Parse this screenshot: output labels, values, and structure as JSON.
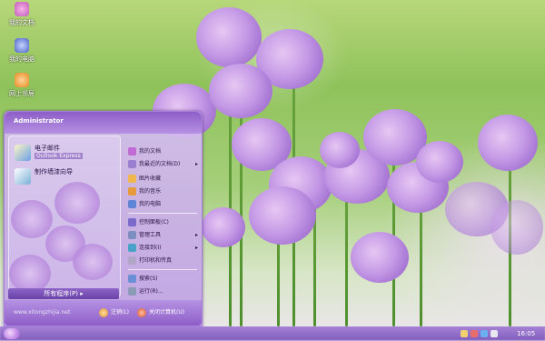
{
  "desktop": {
    "icons": [
      {
        "name": "我的文档",
        "icon": "my-documents-icon"
      },
      {
        "name": "我的电脑",
        "icon": "my-computer-icon"
      },
      {
        "name": "网上邻居",
        "icon": "network-places-icon"
      }
    ]
  },
  "start_menu": {
    "user": "Administrator",
    "pinned": [
      {
        "title": "电子邮件",
        "subtitle": "Outlook Express",
        "icon": "email-icon"
      },
      {
        "title": "制作墙漆向导",
        "icon": "wizard-icon"
      }
    ],
    "all_programs": "所有程序(P)",
    "right": [
      {
        "label": "我的文档",
        "icon": "my-documents-icon"
      },
      {
        "label": "我最近的文档(D)",
        "icon": "recent-documents-icon",
        "arrow": "▸"
      },
      {
        "label": "图片收藏",
        "icon": "pictures-icon"
      },
      {
        "label": "我的音乐",
        "icon": "music-icon"
      },
      {
        "label": "我的电脑",
        "icon": "computer-icon"
      },
      {
        "label": "控制面板(C)",
        "icon": "control-panel-icon"
      },
      {
        "label": "管理工具",
        "icon": "admin-tools-icon",
        "arrow": "▸"
      },
      {
        "label": "连接到(I)",
        "icon": "connect-icon",
        "arrow": "▸"
      },
      {
        "label": "打印机和传真",
        "icon": "printer-icon"
      },
      {
        "label": "搜索(S)",
        "icon": "search-icon"
      },
      {
        "label": "运行(R)...",
        "icon": "run-icon"
      }
    ],
    "website": "www.xitongzhijia.net",
    "logoff": "注销(L)",
    "shutdown": "关闭计算机(U)"
  },
  "taskbar": {
    "clock": "16:05"
  },
  "colors": {
    "taskbar": "#7f5cbc",
    "menu_header": "#8e5ec8",
    "accent": "#a776d4"
  }
}
